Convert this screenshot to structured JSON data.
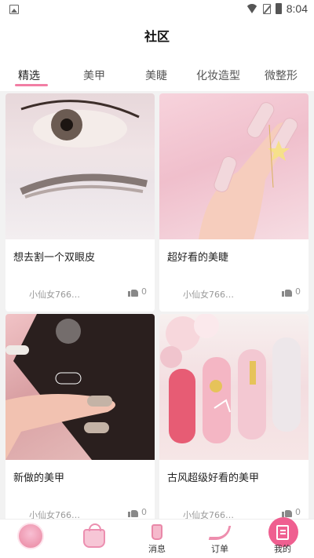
{
  "status_bar": {
    "time": "8:04"
  },
  "header": {
    "title": "社区"
  },
  "tabs": [
    {
      "label": "精选",
      "active": true
    },
    {
      "label": "美甲"
    },
    {
      "label": "美睫"
    },
    {
      "label": "化妆造型"
    },
    {
      "label": "微整形"
    }
  ],
  "posts": [
    {
      "caption": "想去割一个双眼皮",
      "author": "小仙女766…",
      "likes": "0"
    },
    {
      "caption": "超好看的美睫",
      "author": "小仙女766…",
      "likes": "0"
    },
    {
      "caption": "新做的美甲",
      "author": "小仙女766…",
      "likes": "0"
    },
    {
      "caption": "古风超级好看的美甲",
      "author": "小仙女766…",
      "likes": "0"
    }
  ],
  "nav": [
    {
      "label": "",
      "icon": "home-avatar-icon"
    },
    {
      "label": "",
      "icon": "bag-icon"
    },
    {
      "label": "消息",
      "icon": "perfume-bottle-icon"
    },
    {
      "label": "订单",
      "icon": "high-heel-icon"
    },
    {
      "label": "我的",
      "icon": "note-icon"
    }
  ],
  "colors": {
    "accent": "#f27ea4",
    "accent_dark": "#ef5f90"
  }
}
